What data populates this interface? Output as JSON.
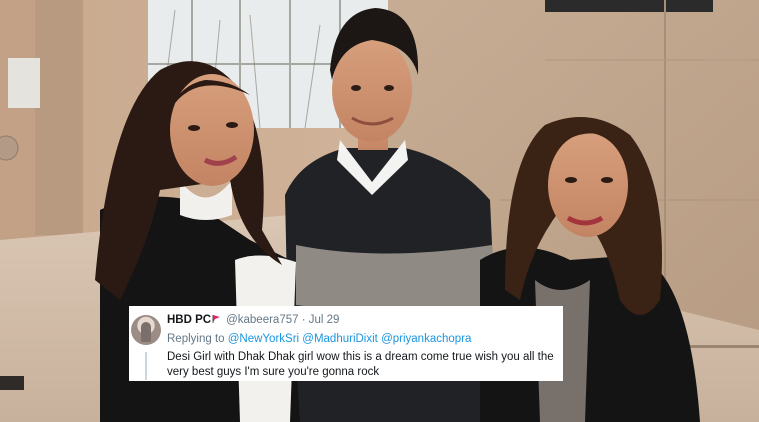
{
  "tweet": {
    "display_name": "HBD PC",
    "flag_icon": "flag-icon",
    "handle": "@kabeera757",
    "separator": "·",
    "date": "Jul 29",
    "replying_to_label": "Replying to",
    "mentions": [
      "@NewYorkSri",
      "@MadhuriDixit",
      "@priyankachopra"
    ],
    "text": "Desi Girl with Dhak Dhak girl wow this is a dream come true wish you all the very best guys I'm sure you're gonna rock"
  },
  "colors": {
    "link": "#1b95e0",
    "meta": "#657786",
    "text": "#14171a"
  }
}
